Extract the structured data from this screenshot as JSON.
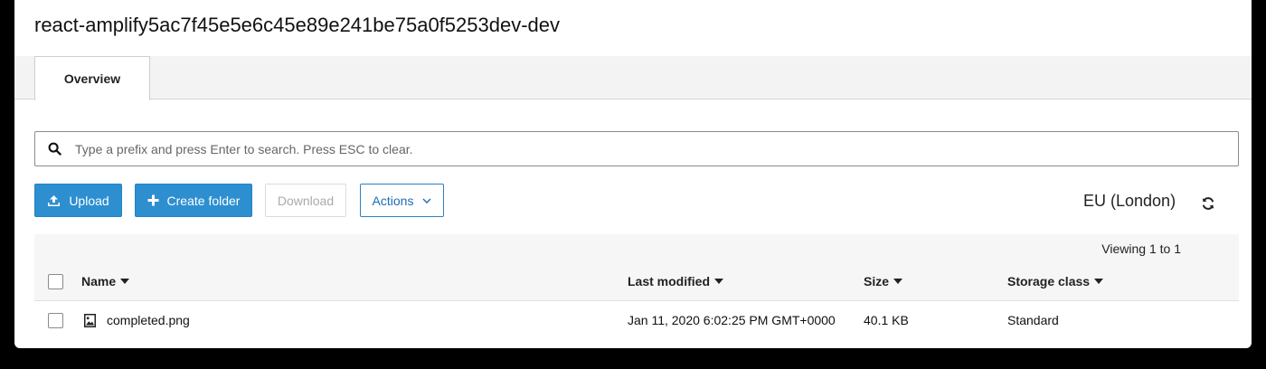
{
  "page": {
    "title": "react-amplify5ac7f45e5e6c45e89e241be75a0f5253dev-dev"
  },
  "tabs": [
    {
      "label": "Overview",
      "active": true
    }
  ],
  "search": {
    "placeholder": "Type a prefix and press Enter to search. Press ESC to clear.",
    "value": "",
    "icon": "search-icon"
  },
  "toolbar": {
    "upload_label": "Upload",
    "create_folder_label": "Create folder",
    "download_label": "Download",
    "actions_label": "Actions",
    "region": "EU (London)",
    "refresh_icon": "refresh-icon"
  },
  "table": {
    "viewing_text": "Viewing 1 to 1",
    "columns": [
      {
        "label": "Name",
        "sortable": true
      },
      {
        "label": "Last modified",
        "sortable": true
      },
      {
        "label": "Size",
        "sortable": true
      },
      {
        "label": "Storage class",
        "sortable": true
      }
    ],
    "rows": [
      {
        "name": "completed.png",
        "icon": "image-file-icon",
        "last_modified": "Jan 11, 2020 6:02:25 PM GMT+0000",
        "size": "40.1 KB",
        "storage_class": "Standard",
        "selected": false
      }
    ]
  },
  "colors": {
    "primary": "#2d8fd0",
    "link": "#1a6db6",
    "disabled_text": "#aaaaaa",
    "tab_strip": "#f3f3f3",
    "header_bg": "#f6f6f6"
  }
}
